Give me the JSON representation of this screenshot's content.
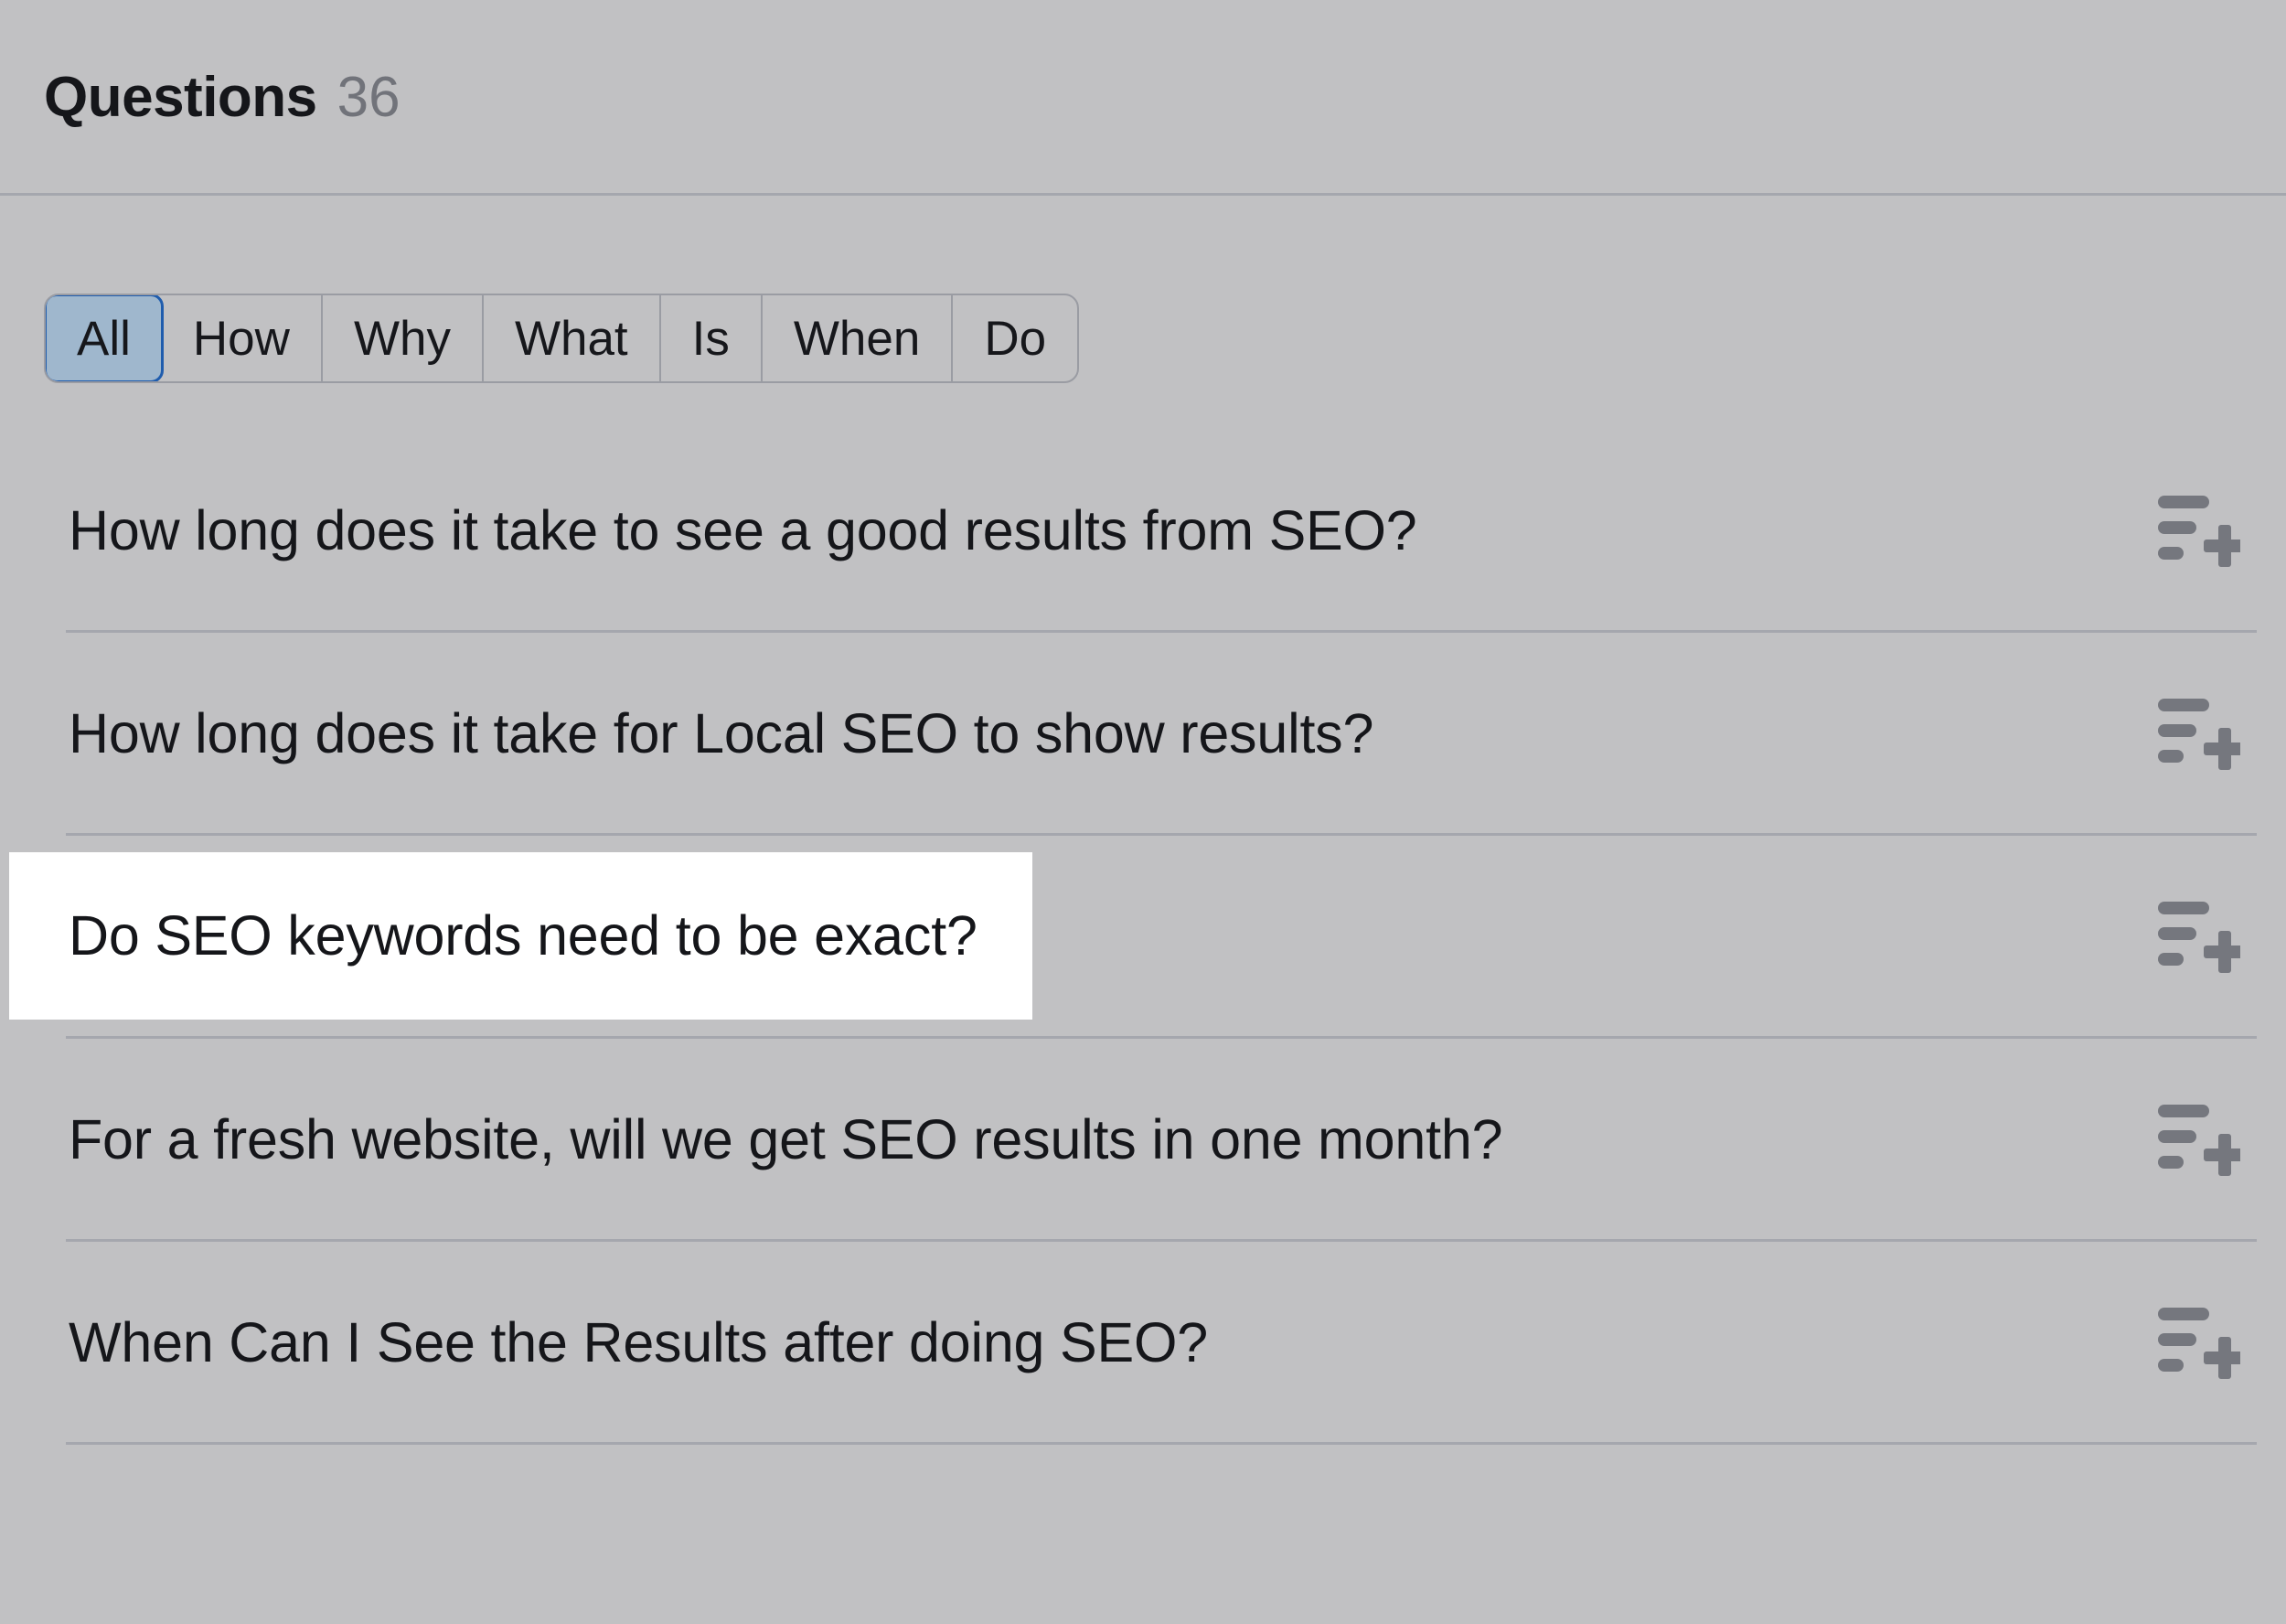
{
  "header": {
    "title": "Questions",
    "count": "36"
  },
  "filters": {
    "active": "All",
    "items": [
      {
        "label": "All",
        "active": true
      },
      {
        "label": "How",
        "active": false
      },
      {
        "label": "Why",
        "active": false
      },
      {
        "label": "What",
        "active": false
      },
      {
        "label": "Is",
        "active": false
      },
      {
        "label": "When",
        "active": false
      },
      {
        "label": "Do",
        "active": false
      }
    ]
  },
  "questions": {
    "action_icon": "add-to-list-icon",
    "items": [
      {
        "text": "How long does it take to see a good results from SEO?",
        "highlighted": false
      },
      {
        "text": "How long does it take for Local SEO to show results?",
        "highlighted": false
      },
      {
        "text": "Do SEO keywords need to be exact?",
        "highlighted": true
      },
      {
        "text": "For a fresh website, will we get SEO results in one month?",
        "highlighted": false
      },
      {
        "text": "When Can I See the Results after doing SEO?",
        "highlighted": false
      }
    ]
  },
  "colors": {
    "background": "#c1c1c3",
    "divider": "#a5a7ae",
    "text": "#15161a",
    "muted_text": "#71737a",
    "active_pill_fill": "#9fb7cd",
    "active_pill_border": "#1f5cad",
    "highlight": "#ffffff",
    "icon": "#75777e"
  }
}
